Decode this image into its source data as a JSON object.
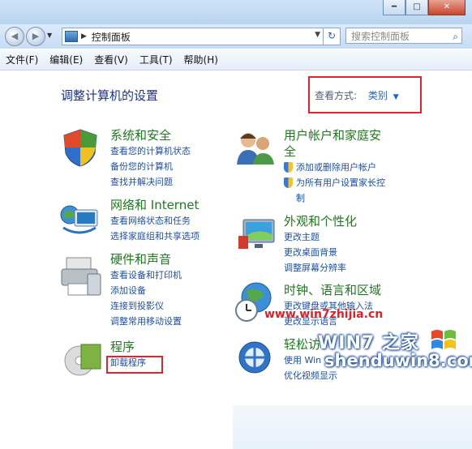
{
  "window": {
    "minimize": "━",
    "maximize": "□",
    "close": "✕"
  },
  "nav": {
    "address": "控制面板",
    "search_placeholder": "搜索控制面板"
  },
  "menu": [
    "文件(F)",
    "编辑(E)",
    "查看(V)",
    "工具(T)",
    "帮助(H)"
  ],
  "header": {
    "title": "调整计算机的设置",
    "view_by_label": "查看方式:",
    "view_by_value": "类别"
  },
  "categories": [
    {
      "title": "系统和安全",
      "icon": "shield-icon",
      "links": [
        "查看您的计算机状态",
        "备份您的计算机",
        "查找并解决问题"
      ]
    },
    {
      "title": "网络和 Internet",
      "icon": "network-icon",
      "links": [
        "查看网络状态和任务",
        "选择家庭组和共享选项"
      ]
    },
    {
      "title": "硬件和声音",
      "icon": "printer-icon",
      "links": [
        "查看设备和打印机",
        "添加设备",
        "连接到投影仪",
        "调整常用移动设置"
      ]
    },
    {
      "title": "程序",
      "icon": "programs-icon",
      "links": [
        "卸载程序"
      ]
    },
    {
      "title_line1": "用户帐户和家庭安",
      "title_line2": "全",
      "icon": "users-icon",
      "links": [
        "添加或删除用户帐户",
        "为所有用户设置家长控",
        "制"
      ]
    },
    {
      "title": "外观和个性化",
      "icon": "monitor-icon",
      "links": [
        "更改主题",
        "更改桌面背景",
        "调整屏幕分辨率"
      ]
    },
    {
      "title": "时钟、语言和区域",
      "icon": "globe-clock-icon",
      "links": [
        "更改键盘或其他输入法",
        "更改显示语言"
      ]
    },
    {
      "title": "轻松访",
      "icon": "ease-of-access-icon",
      "links": [
        "使用 Win",
        "优化视频显示"
      ]
    }
  ],
  "watermark": {
    "site": "www.win7zhijia.cn",
    "brand": "WIN7 之家",
    "site2": "shenduwin8.com"
  },
  "colors": {
    "highlight_box": "#e0242c",
    "category_title": "#1e7a1e",
    "link": "#1c4fa8",
    "page_title": "#1e3287"
  }
}
